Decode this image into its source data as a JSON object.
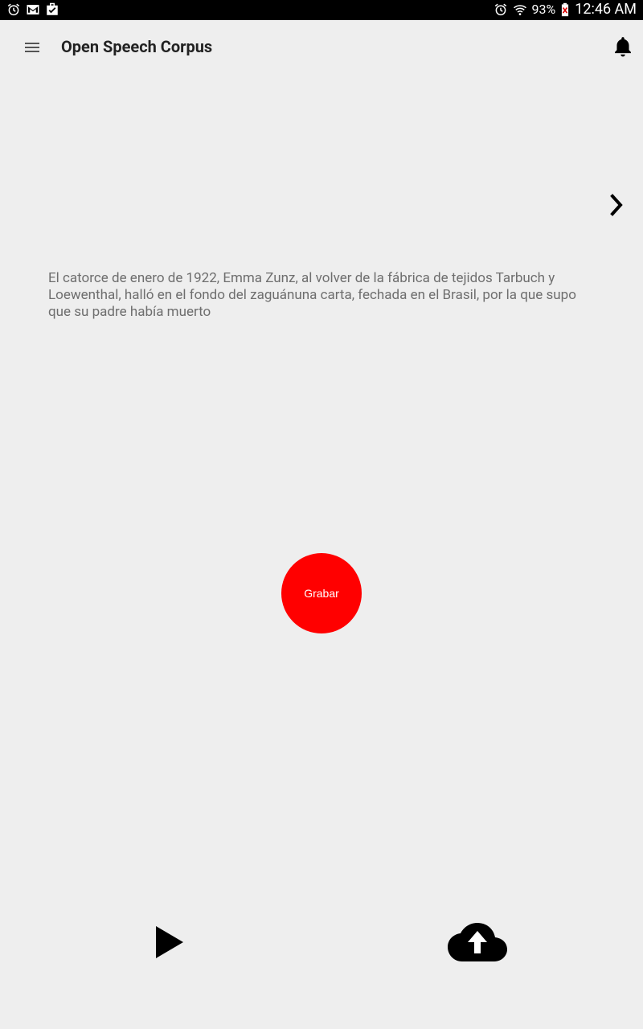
{
  "status_bar": {
    "left_icons": [
      "alarm-icon",
      "gmail-icon",
      "calendar-check-icon"
    ],
    "right_icons": [
      "alarm-icon",
      "wifi-icon",
      "battery-icon"
    ],
    "battery_percent": "93%",
    "time": "12:46 AM"
  },
  "app_bar": {
    "title": "Open Speech Corpus",
    "menu_icon": "hamburger-menu-icon",
    "notification_icon": "bell-icon"
  },
  "content": {
    "next_icon": "chevron-right-icon",
    "sentence": "El catorce de enero de 1922, Emma Zunz, al volver de la fábrica de tejidos Tarbuch y Loewenthal, halló en el fondo del zaguánuna carta, fechada en el Brasil, por la que supo que su padre había muerto",
    "record_button_label": "Grabar",
    "record_button_color": "#ff0000"
  },
  "bottom_bar": {
    "play_icon": "play-icon",
    "upload_icon": "cloud-upload-icon"
  }
}
